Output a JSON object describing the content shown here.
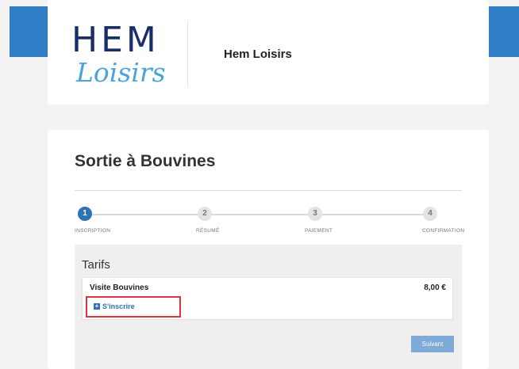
{
  "header": {
    "logo_line1": "HEM",
    "logo_line2": "Loisirs",
    "site_title": "Hem Loisirs"
  },
  "main": {
    "page_title": "Sortie à Bouvines",
    "steps": [
      {
        "number": "1",
        "label": "INSCRIPTION",
        "active": true
      },
      {
        "number": "2",
        "label": "RÉSUMÉ",
        "active": false
      },
      {
        "number": "3",
        "label": "PAIEMENT",
        "active": false
      },
      {
        "number": "4",
        "label": "CONFIRMATION",
        "active": false
      }
    ],
    "tarifs": {
      "heading": "Tarifs",
      "item_name": "Visite Bouvines",
      "item_price": "8,00 €",
      "register_label": "S'inscrire"
    },
    "next_label": "Suivant"
  },
  "colors": {
    "brand_blue": "#2f7dc4",
    "link_blue": "#2e74b5",
    "highlight_red": "#e0323f",
    "button_blue": "#7fa9d6"
  },
  "icons": {
    "register": "plus-square-icon"
  }
}
